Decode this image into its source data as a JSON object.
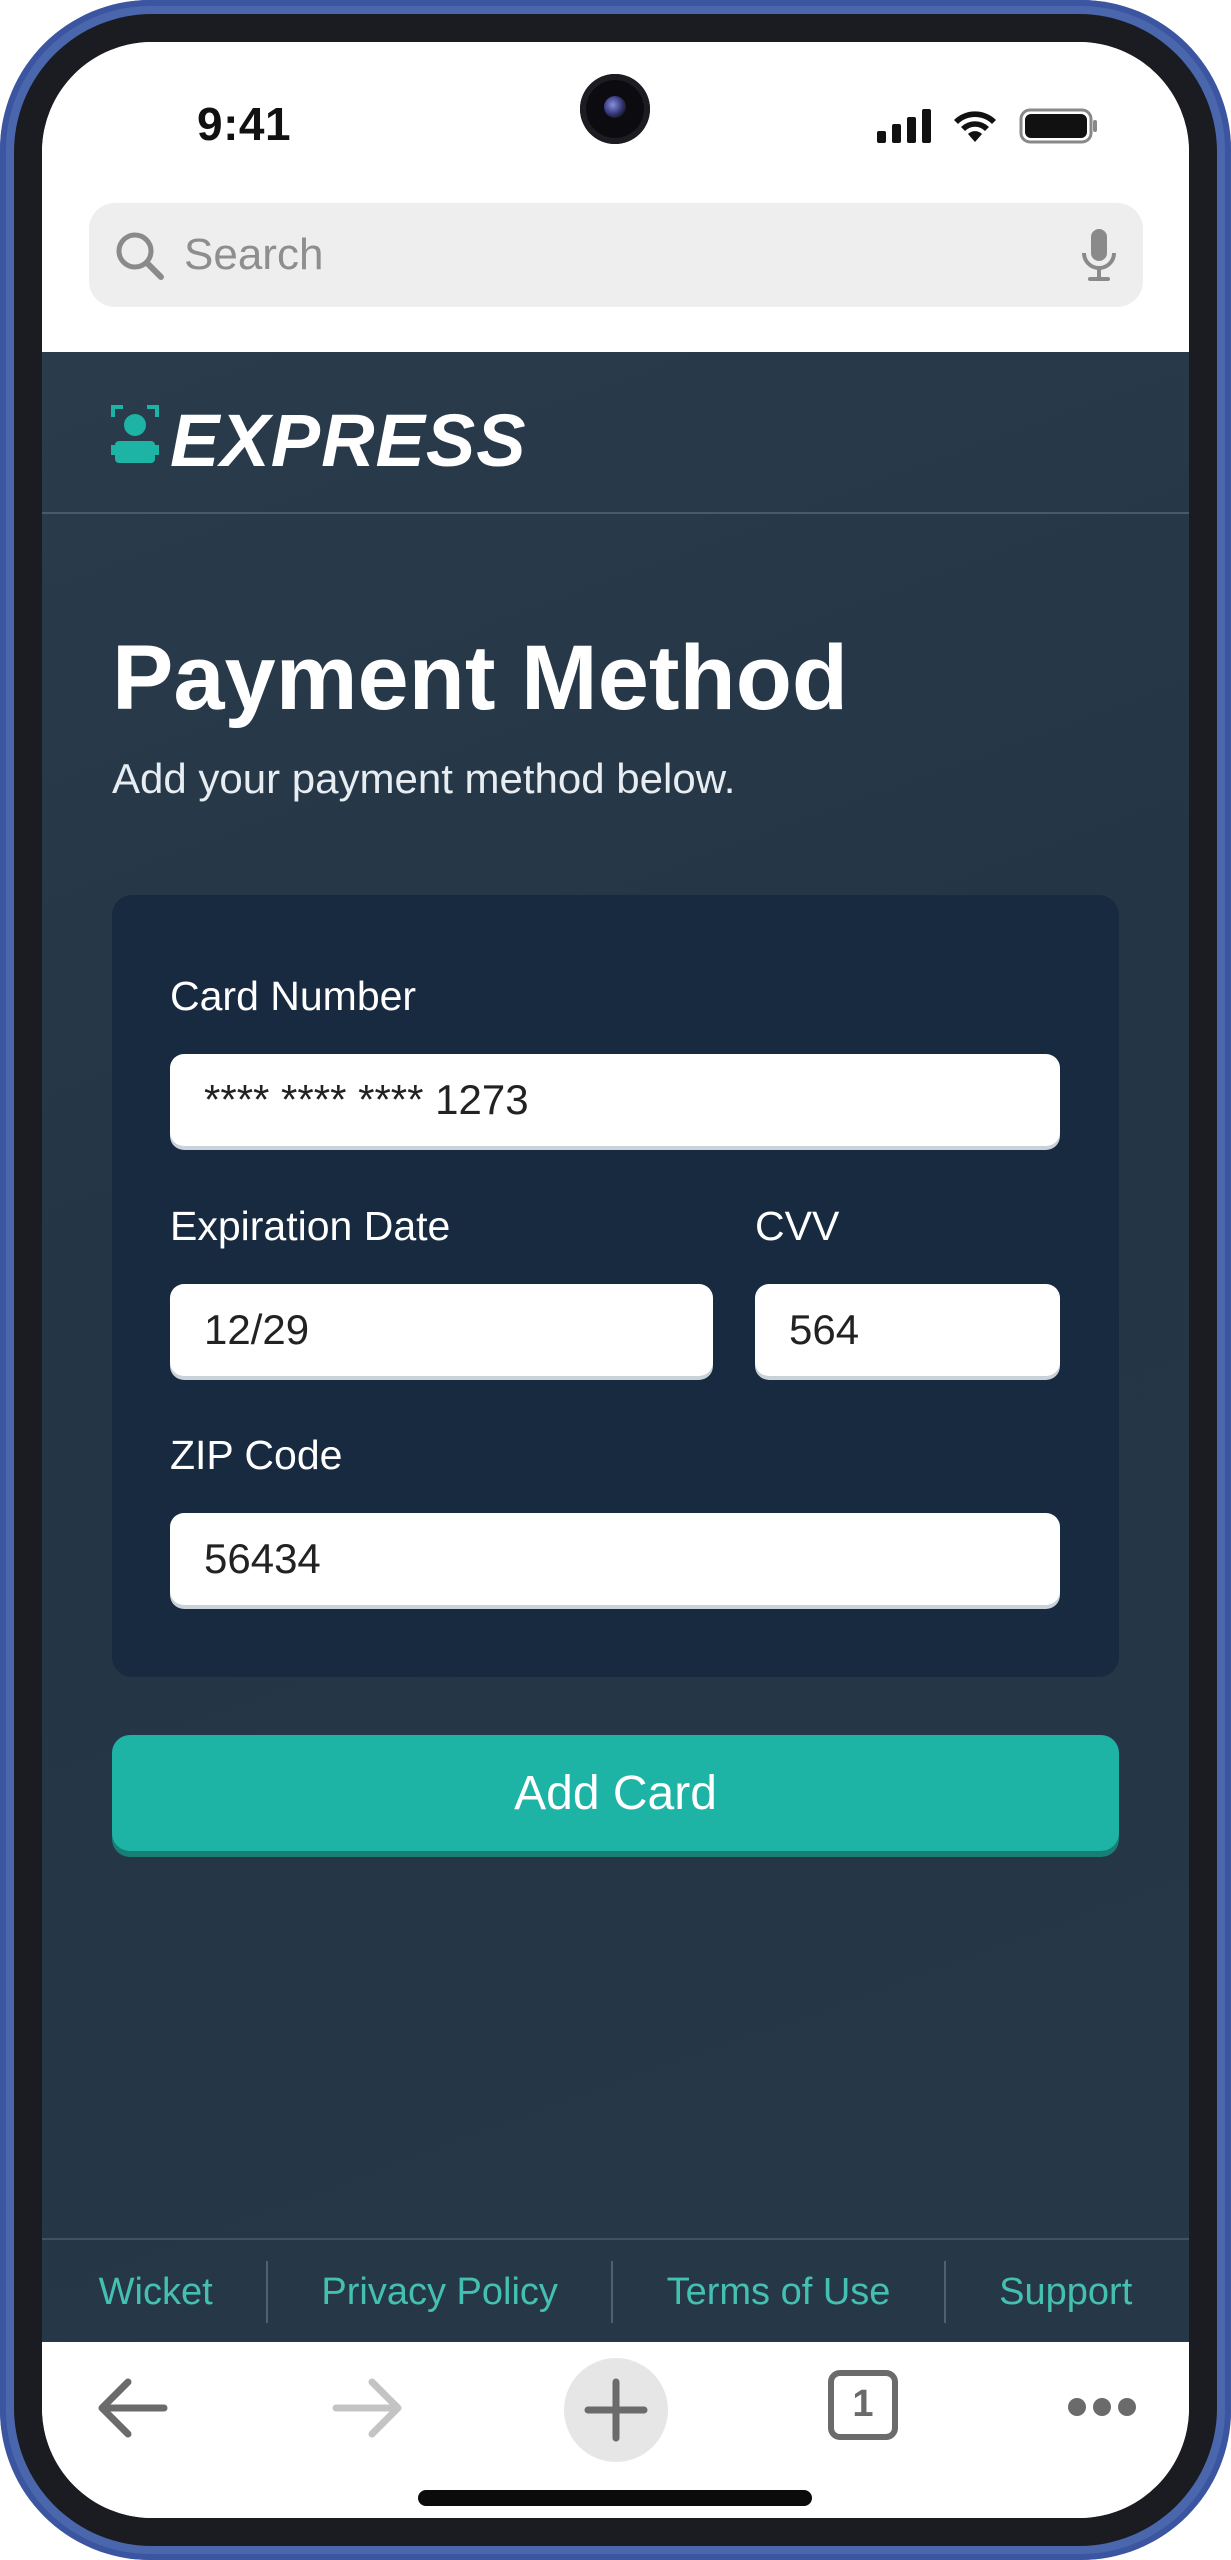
{
  "status_bar": {
    "time": "9:41",
    "icons": [
      "signal-icon",
      "wifi-icon",
      "battery-icon"
    ]
  },
  "browser": {
    "search_placeholder": "Search",
    "tab_count": "1",
    "toolbar_icons": [
      "back-arrow-icon",
      "forward-arrow-icon",
      "plus-icon",
      "tabs-icon",
      "more-icon"
    ]
  },
  "brand": {
    "name": "EXPRESS",
    "icon": "user-badge-icon"
  },
  "page": {
    "title": "Payment Method",
    "subtitle": "Add your payment method below."
  },
  "form": {
    "card_number": {
      "label": "Card Number",
      "value": "**** **** **** 1273"
    },
    "expiration": {
      "label": "Expiration Date",
      "value": "12/29"
    },
    "cvv": {
      "label": "CVV",
      "value": "564"
    },
    "zip": {
      "label": "ZIP Code",
      "value": "56434"
    },
    "submit_label": "Add Card"
  },
  "footer": {
    "links": [
      "Wicket",
      "Privacy Policy",
      "Terms of Use",
      "Support"
    ]
  },
  "colors": {
    "background": "#263848",
    "panel": "#182a3f",
    "accent": "#1db3a5",
    "link": "#44c0b3",
    "frame": "#4a67ad"
  }
}
